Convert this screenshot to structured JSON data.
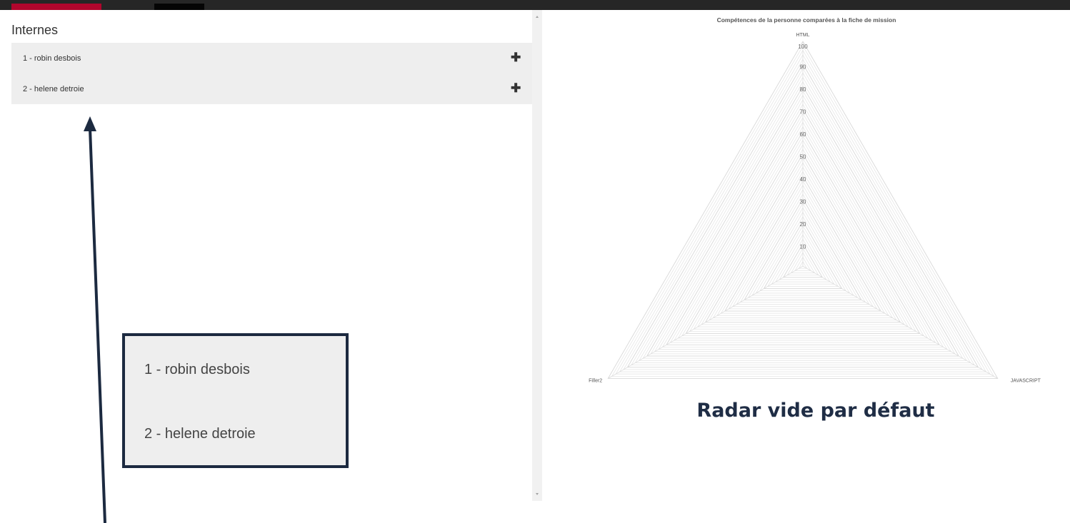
{
  "colors": {
    "topbar": "#262626",
    "accent": "#b0062d",
    "list_bg": "#eeeeee",
    "annotation": "#1c2a40",
    "grid": "#dddddd"
  },
  "left_panel": {
    "title": "Internes",
    "items": [
      {
        "label": "1 - robin desbois",
        "icon": "plus-icon"
      },
      {
        "label": "2 - helene detroie",
        "icon": "plus-icon"
      }
    ]
  },
  "zoom_box": {
    "items": [
      "1 - robin desbois",
      "2 - helene detroie"
    ]
  },
  "caption": "Radar vide par défaut",
  "chart_data": {
    "type": "radar",
    "title": "Compétences de la personne comparées à la fiche de mission",
    "axes": [
      "HTML",
      "JAVASCRIPT",
      "Filler2"
    ],
    "rlim": [
      0,
      100
    ],
    "ticks": [
      10,
      20,
      30,
      40,
      50,
      60,
      70,
      80,
      90,
      100
    ],
    "series": [],
    "grid": true
  }
}
